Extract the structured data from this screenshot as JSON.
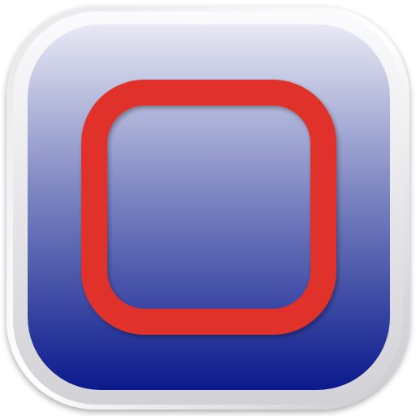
{
  "app_icon": {
    "icon_name": "rounded-square-icon",
    "colors": {
      "frame_outer": "#d2d2d6",
      "frame_highlight": "#fbfbfd",
      "tile_top": "#e8e9f4",
      "tile_mid": "#7f87c2",
      "tile_bottom": "#0a1a8c",
      "ring": "#e0332a",
      "ring_shadow": "#b3241e"
    }
  }
}
